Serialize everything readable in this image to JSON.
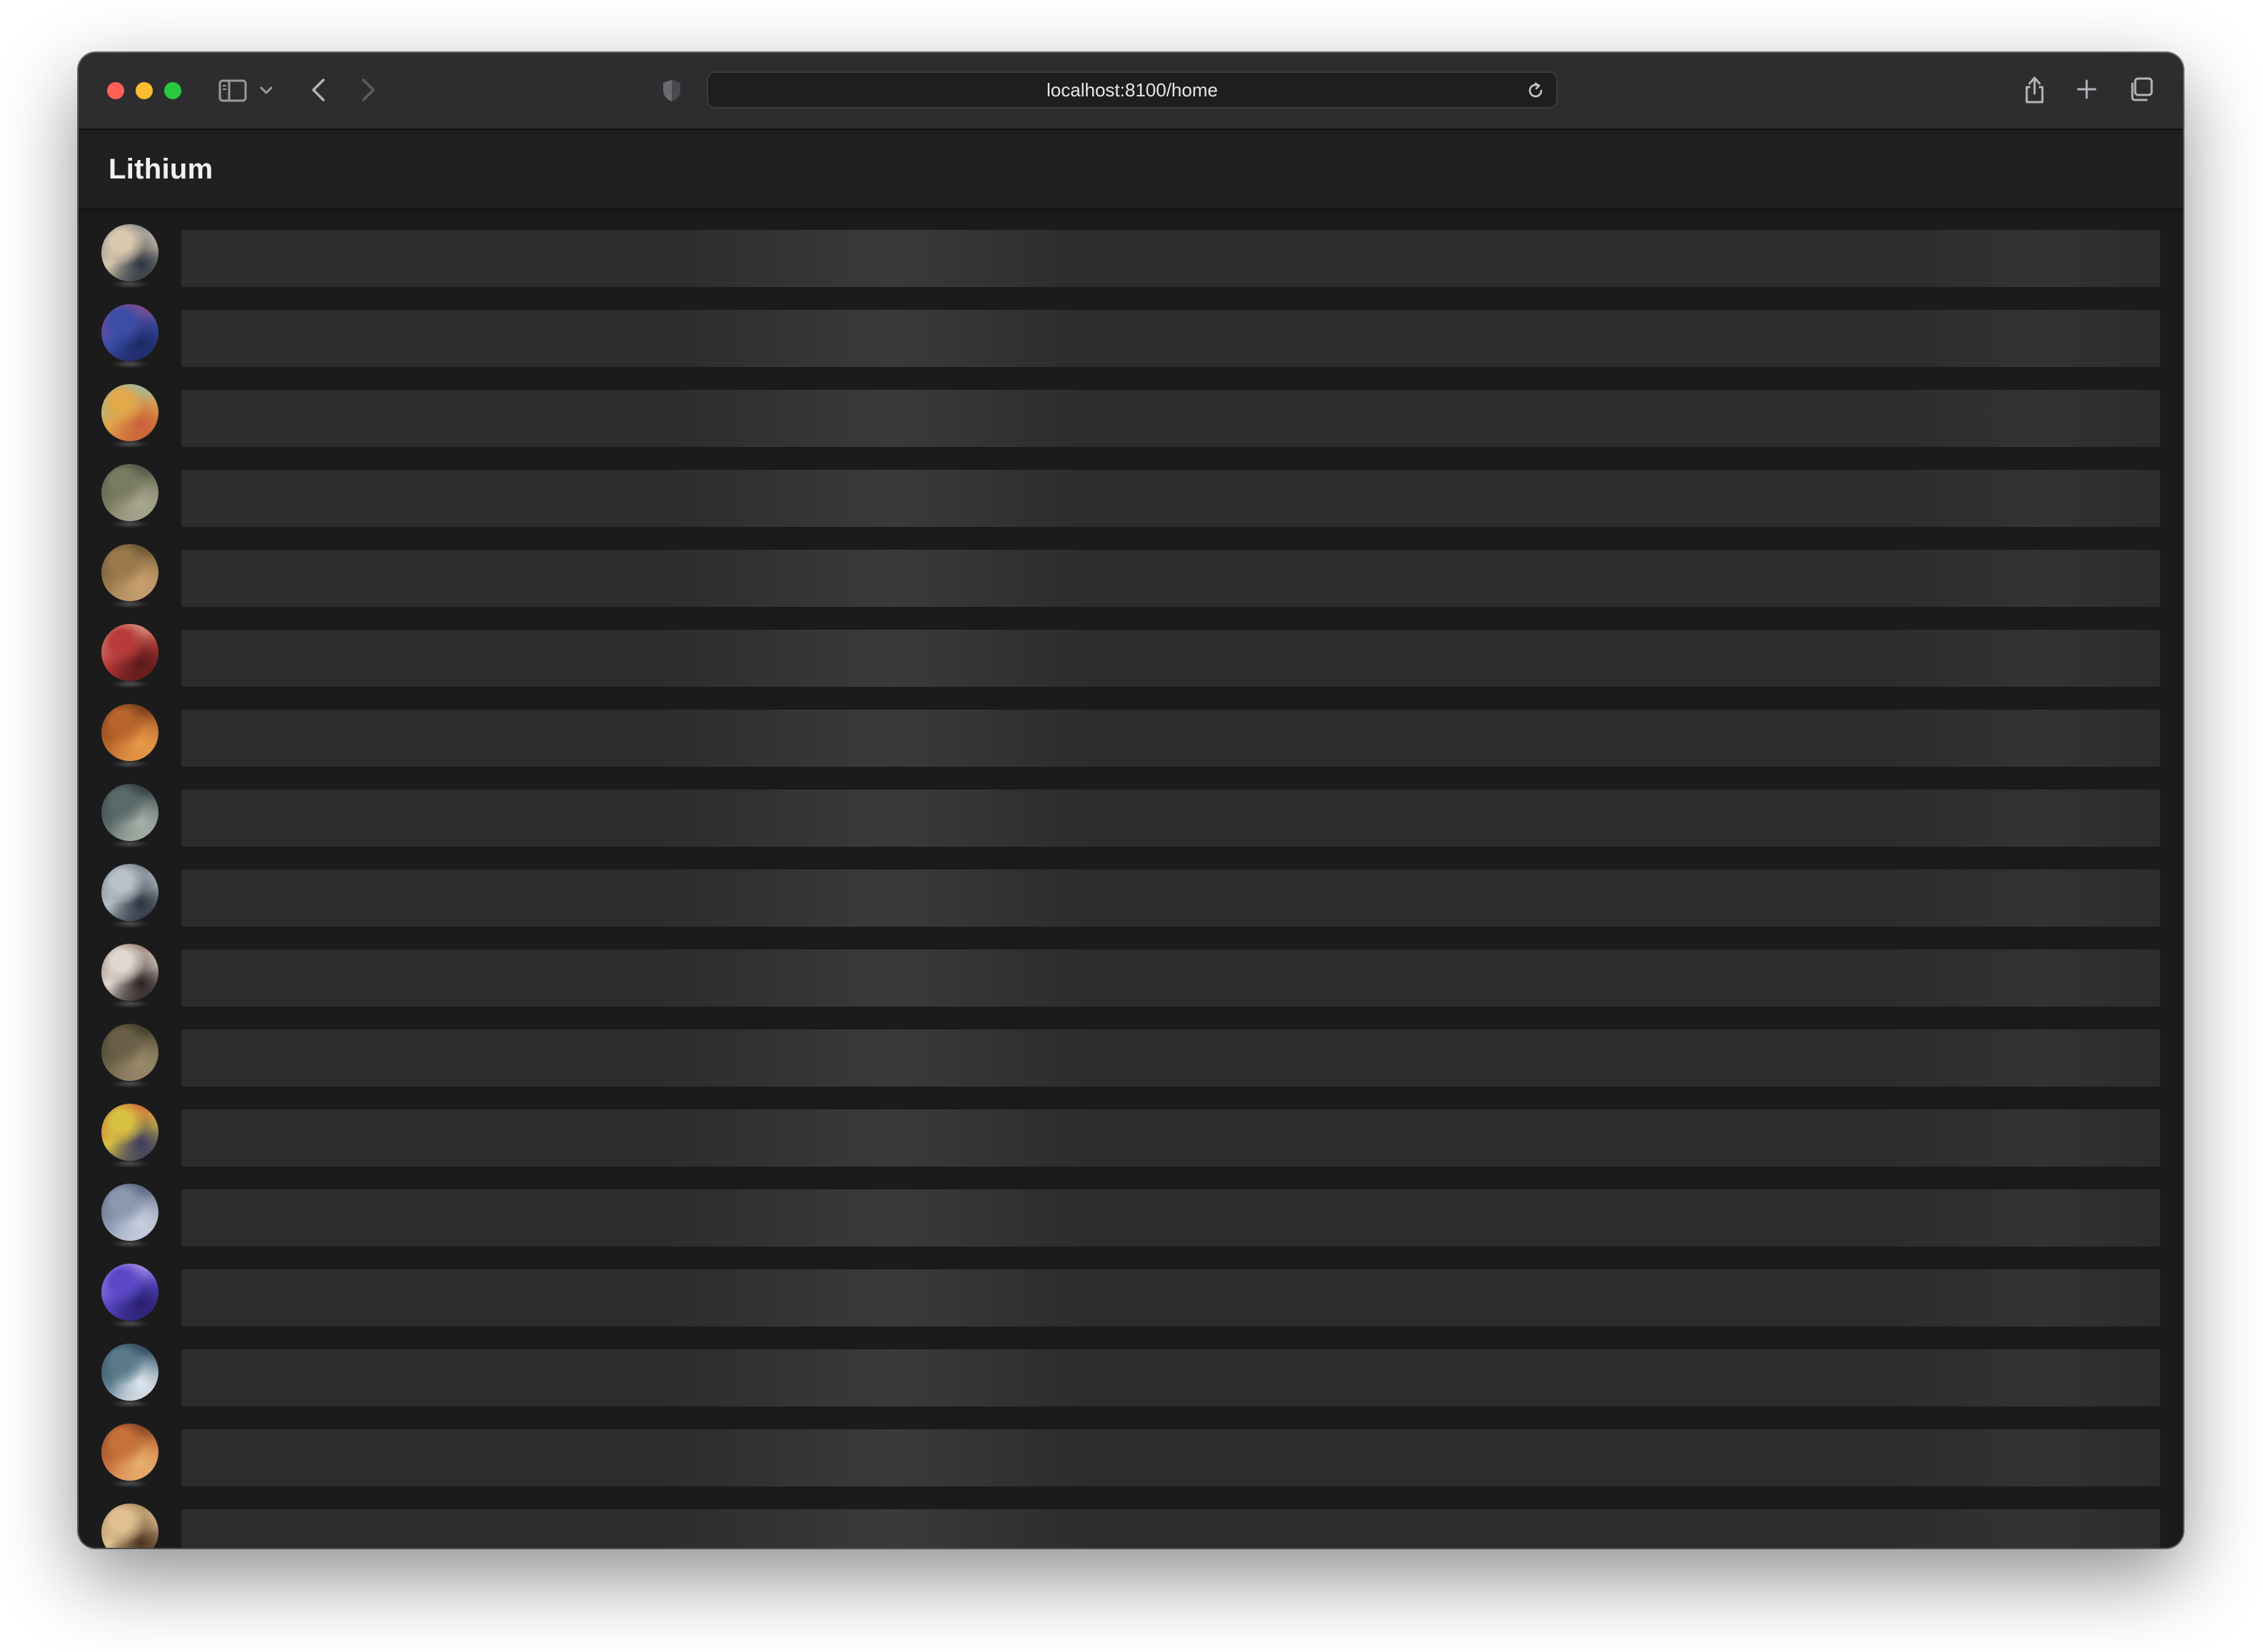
{
  "browser": {
    "url": "localhost:8100/home",
    "traffic_lights": [
      "close",
      "minimize",
      "zoom"
    ],
    "icons": {
      "sidebar": "sidebar-icon",
      "chevron": "chevron-down-icon",
      "back": "back-arrow-icon",
      "forward": "forward-arrow-icon",
      "shield": "privacy-shield-icon",
      "reload": "reload-icon",
      "share": "share-icon",
      "new_tab": "plus-icon",
      "tabs": "tab-overview-icon"
    }
  },
  "app": {
    "title": "Lithium"
  },
  "list": {
    "state": "loading",
    "items": [
      {
        "avatar_colors": [
          "#d9c8ae",
          "#5a6a7a",
          "#2a3440"
        ]
      },
      {
        "avatar_colors": [
          "#3a4ea8",
          "#b24a7a",
          "#1e2a66"
        ]
      },
      {
        "avatar_colors": [
          "#e2a84a",
          "#6cc0d8",
          "#c8603a"
        ]
      },
      {
        "avatar_colors": [
          "#7a7c62",
          "#3c3d30",
          "#a8a890"
        ]
      },
      {
        "avatar_colors": [
          "#9a7a4a",
          "#4a3a28",
          "#c8a070"
        ]
      },
      {
        "avatar_colors": [
          "#b83a3a",
          "#e8c0a0",
          "#5a1a1a"
        ]
      },
      {
        "avatar_colors": [
          "#b8642a",
          "#4a2410",
          "#e89a4a"
        ]
      },
      {
        "avatar_colors": [
          "#5a6a6a",
          "#1a2224",
          "#a8b0a8"
        ]
      },
      {
        "avatar_colors": [
          "#b8c0c8",
          "#4a5866",
          "#2a3440"
        ]
      },
      {
        "avatar_colors": [
          "#e0d8d0",
          "#6a4a3a",
          "#2a2020"
        ]
      },
      {
        "avatar_colors": [
          "#6a6048",
          "#2a2618",
          "#9a8a6a"
        ]
      },
      {
        "avatar_colors": [
          "#d8c040",
          "#c83a3a",
          "#3a3a60"
        ]
      },
      {
        "avatar_colors": [
          "#8a98b0",
          "#3a4460",
          "#c8d0e0"
        ]
      },
      {
        "avatar_colors": [
          "#5a48c8",
          "#c8b0f0",
          "#2a2070"
        ]
      },
      {
        "avatar_colors": [
          "#5a7a8a",
          "#1a3040",
          "#e0e8f0"
        ]
      },
      {
        "avatar_colors": [
          "#c8703a",
          "#5a2a18",
          "#e8b070"
        ]
      },
      {
        "avatar_colors": [
          "#e0c090",
          "#8a6a40",
          "#4a3420"
        ]
      }
    ]
  }
}
